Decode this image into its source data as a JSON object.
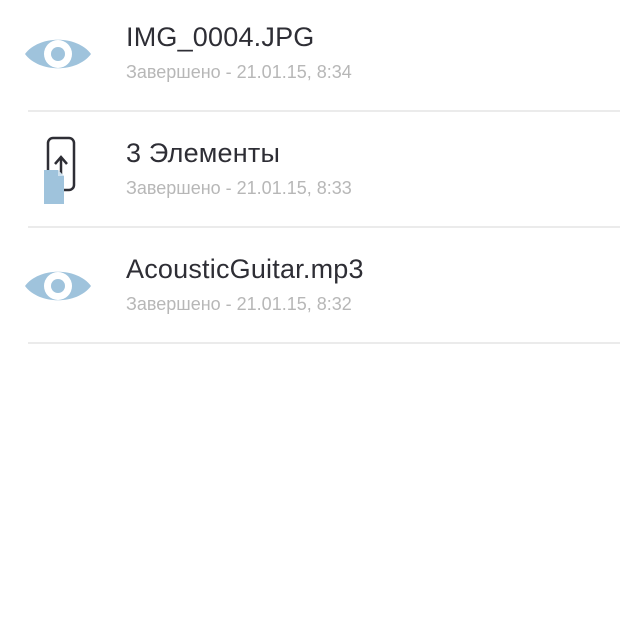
{
  "colors": {
    "icon_blue": "#9fc3dc",
    "title_text": "#2e2e35",
    "subtitle_text": "#b7b7b7",
    "divider": "#ebebeb"
  },
  "downloads": [
    {
      "icon": "eye-icon",
      "title": "IMG_0004.JPG",
      "status": "Завершено - 21.01.15, 8:34"
    },
    {
      "icon": "phone-transfer-icon",
      "title": "3 Элементы",
      "status": "Завершено - 21.01.15, 8:33"
    },
    {
      "icon": "eye-icon",
      "title": "AcousticGuitar.mp3",
      "status": "Завершено - 21.01.15, 8:32"
    }
  ]
}
